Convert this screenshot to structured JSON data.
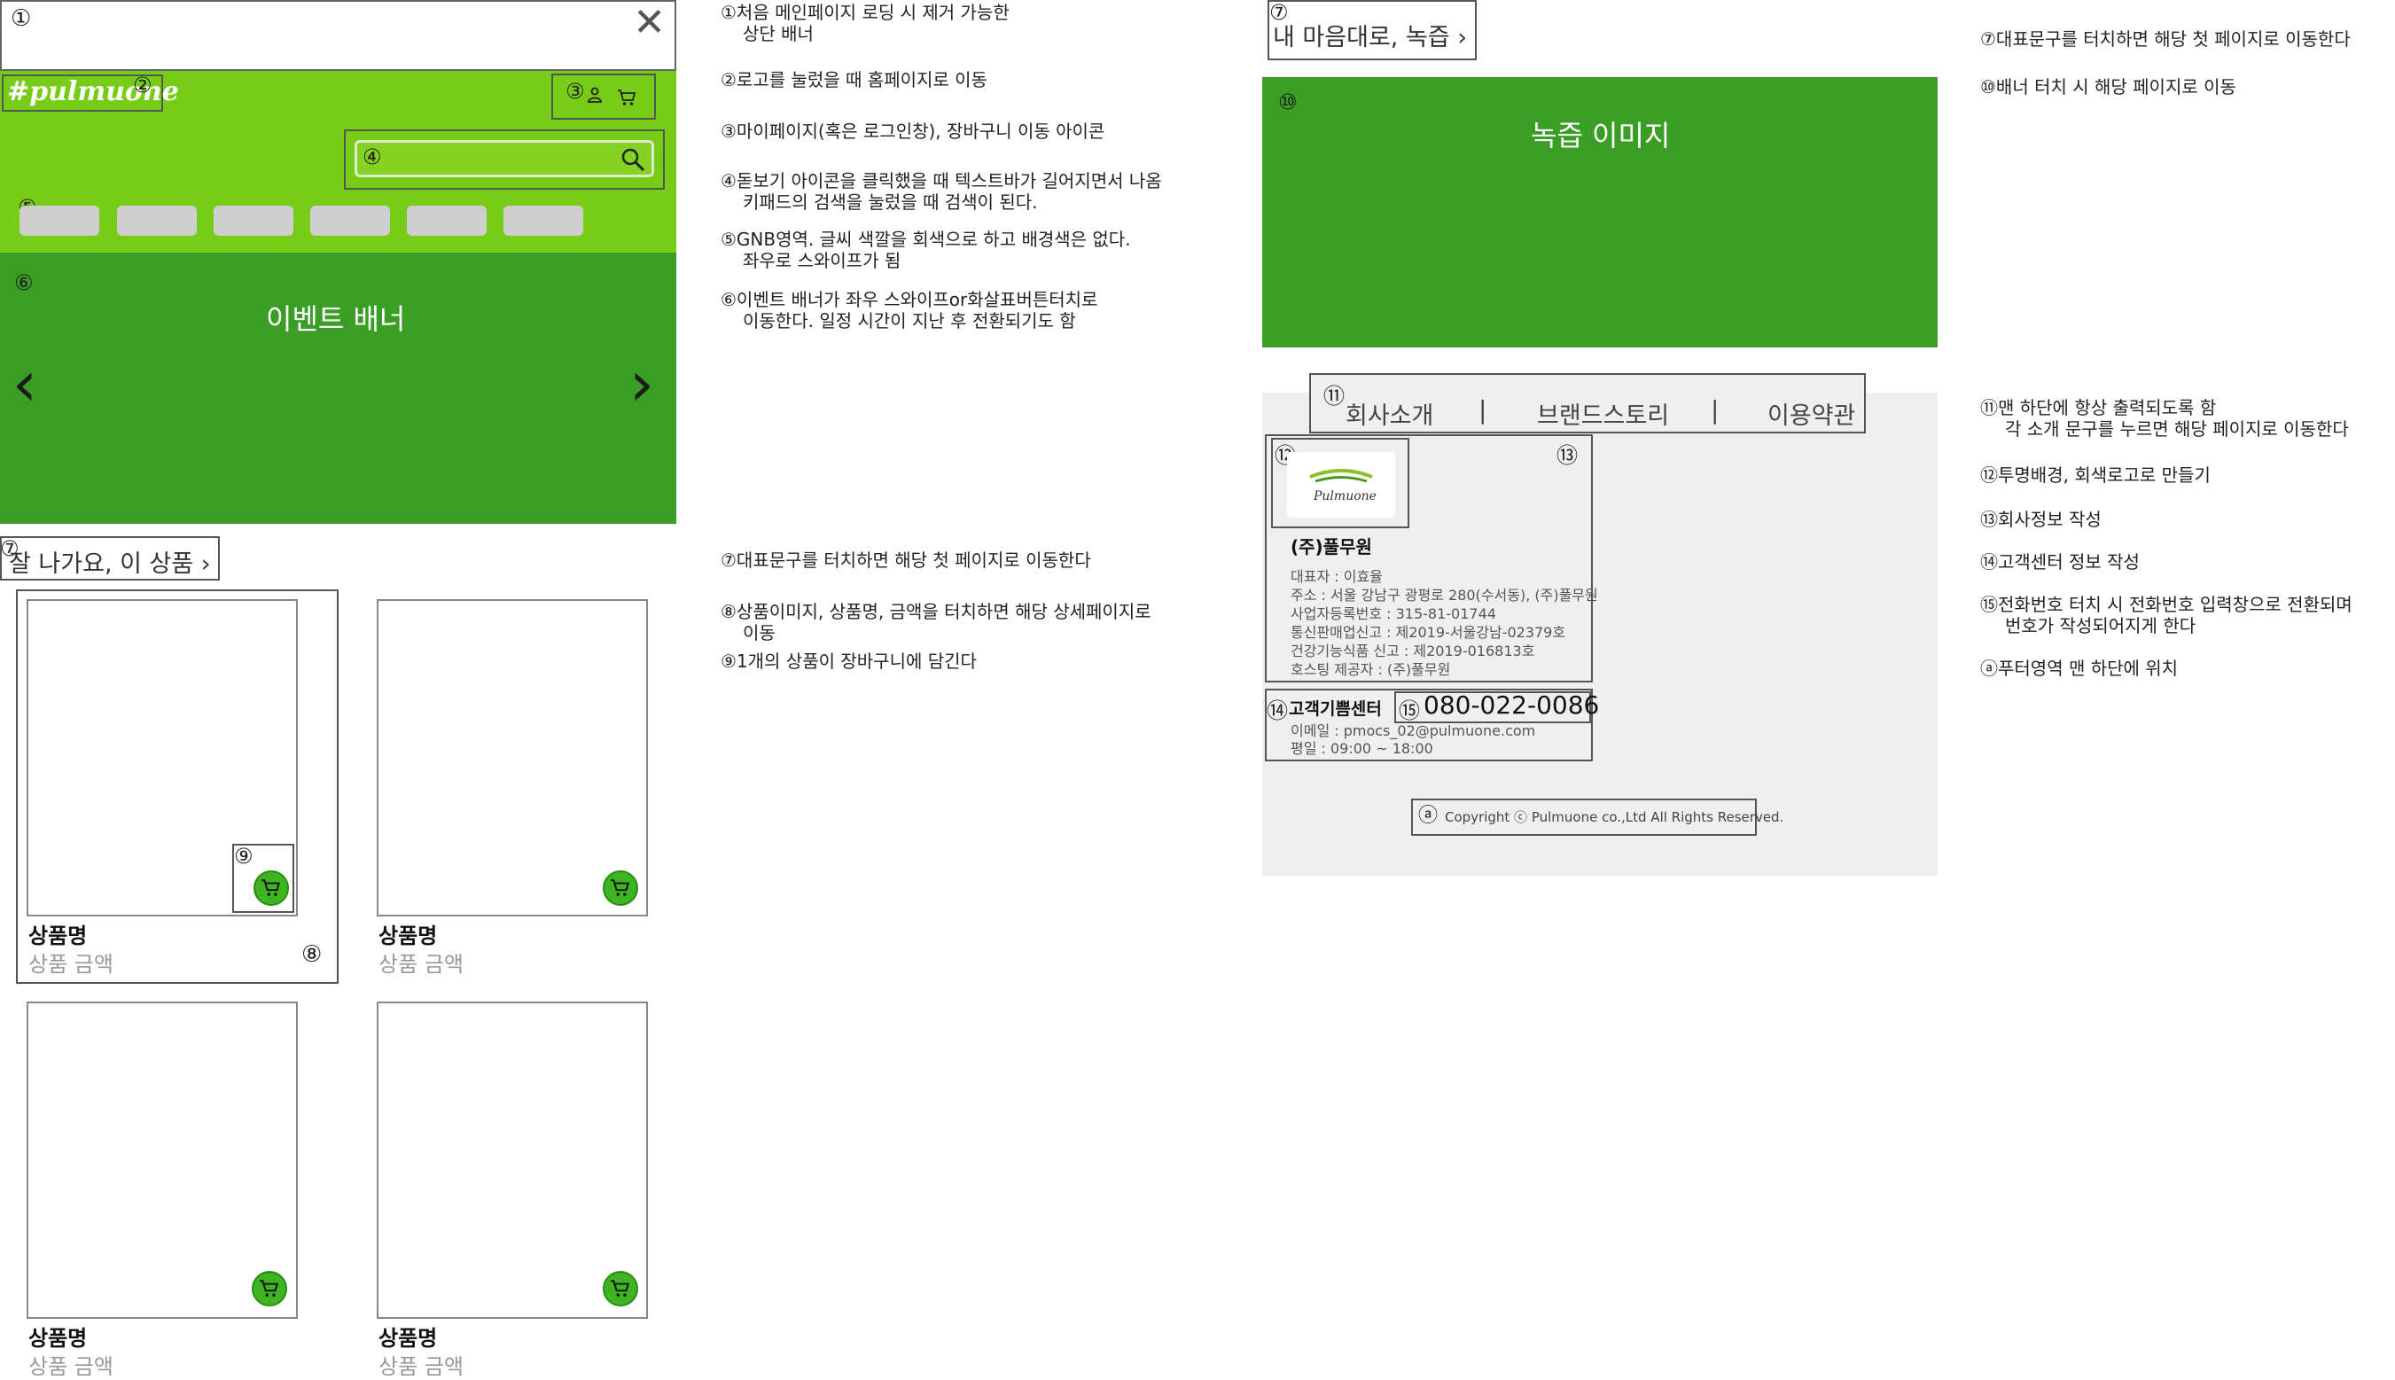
{
  "top_banner": {
    "num": "①",
    "close": "✕"
  },
  "header": {
    "logo": "#pulmuone",
    "logo_num": "②",
    "icons_num": "③"
  },
  "search": {
    "num": "④",
    "placeholder": "",
    "value": ""
  },
  "gnb": {
    "num": "⑤"
  },
  "event_banner": {
    "num": "⑥",
    "title": "이벤트 배너",
    "prev": "‹",
    "next": "›"
  },
  "best_section": {
    "num": "⑦",
    "title": "잘 나가요, 이 상품 ›"
  },
  "products": [
    {
      "name": "상품명",
      "price": "상품 금액"
    },
    {
      "name": "상품명",
      "price": "상품 금액"
    },
    {
      "name": "상품명",
      "price": "상품 금액"
    },
    {
      "name": "상품명",
      "price": "상품 금액"
    }
  ],
  "markers": {
    "product": "⑧",
    "cart": "⑨"
  },
  "annotations_left": [
    "①처음 메인페이지 로딩 시 제거 가능한",
    "상단 배너",
    "②로고를 눌렀을 때 홈페이지로 이동",
    "③마이페이지(혹은 로그인창), 장바구니 이동 아이콘",
    "④돋보기 아이콘을 클릭했을 때 텍스트바가 길어지면서 나옴",
    "키패드의 검색을 눌렀을 때 검색이 된다.",
    "⑤GNB영역. 글씨 색깔을 회색으로 하고 배경색은 없다.",
    "좌우로 스와이프가 됨",
    "⑥이벤트 배너가 좌우 스와이프or화살표버튼터치로",
    "이동한다. 일정 시간이 지난 후 전환되기도 함",
    "⑦대표문구를 터치하면 해당 첫 페이지로 이동한다",
    "⑧상품이미지, 상품명, 금액을 터치하면 해당 상세페이지로",
    "이동",
    "⑨1개의 상품이 장바구니에 담긴다"
  ],
  "nokjup": {
    "num": "⑦",
    "title": "내 마음대로, 녹즙 ›",
    "img_num": "⑩",
    "img_label": "녹즙 이미지"
  },
  "footer": {
    "links_num": "⑪",
    "links": [
      "회사소개",
      "브랜드스토리",
      "이용약관"
    ],
    "sep": "|",
    "logo_num": "⑫",
    "logo_text": "Pulmuone",
    "info_num": "⑬",
    "company_name": "(주)풀무원",
    "company_info": [
      "대표자 : 이효율",
      "주소 : 서울 강남구 광평로 280(수서동), (주)풀무원",
      "사업자등록번호 : 315-81-01744",
      "통신판매업신고 : 제2019-서울강남-02379호",
      "건강기능식품 신고 : 제2019-016813호",
      "호스팅 제공자 : (주)풀무원"
    ],
    "cs_num": "⑭",
    "cs_title": "고객기쁨센터",
    "tel_num": "⑮",
    "tel": "080-022-0086",
    "cs_info": [
      "이메일 : pmocs_02@pulmuone.com",
      "평일 : 09:00 ~ 18:00"
    ],
    "copy_num": "ⓐ",
    "copyright": "Copyright ⓒ Pulmuone co.,Ltd All Rights Reserved."
  },
  "annotations_right": [
    "⑦대표문구를 터치하면 해당 첫 페이지로 이동한다",
    "⑩배너 터치 시 해당 페이지로 이동",
    "⑪맨 하단에 항상 출력되도록 함",
    "각 소개 문구를 누르면 해당 페이지로 이동한다",
    "⑫투명배경, 회색로고로 만들기",
    "⑬회사정보 작성",
    "⑭고객센터 정보 작성",
    "⑮전화번호 터치 시 전화번호 입력창으로 전환되며",
    "번호가 작성되어지게 한다",
    "ⓐ푸터영역 맨 하단에 위치"
  ],
  "colors": {
    "header_green": "#77cc17",
    "banner_green": "#3a9d26",
    "cart_green": "#3fb422",
    "footer_gray": "#efefef"
  }
}
